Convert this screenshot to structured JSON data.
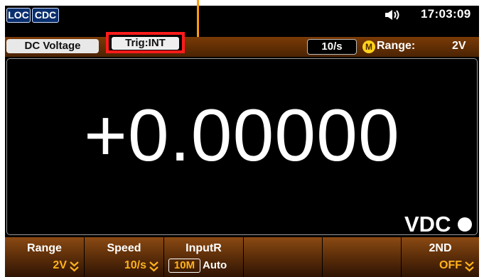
{
  "top_bar": {
    "loc_badge": "LOC",
    "cdc_badge": "CDC",
    "time": "17:03:09",
    "sound_icon": "speaker-icon"
  },
  "status": {
    "mode": "DC Voltage",
    "trigger": "Trig:INT",
    "rate": "10/s",
    "range_label": "Range:",
    "range_value": "2V",
    "range_mode_icon": "M"
  },
  "display": {
    "reading": "+0.00000",
    "unit": "VDC"
  },
  "softkeys": [
    {
      "title": "Range",
      "value": "2V"
    },
    {
      "title": "Speed",
      "value": "10/s"
    },
    {
      "title": "InputR",
      "value": "10M",
      "alt": "Auto"
    },
    {
      "title": "",
      "value": ""
    },
    {
      "title": "",
      "value": ""
    },
    {
      "title": "2ND",
      "value": "OFF"
    }
  ],
  "colors": {
    "accent": "#ffb21d",
    "highlight": "#ff1b1b",
    "softkey_top": "#8b4a13"
  }
}
